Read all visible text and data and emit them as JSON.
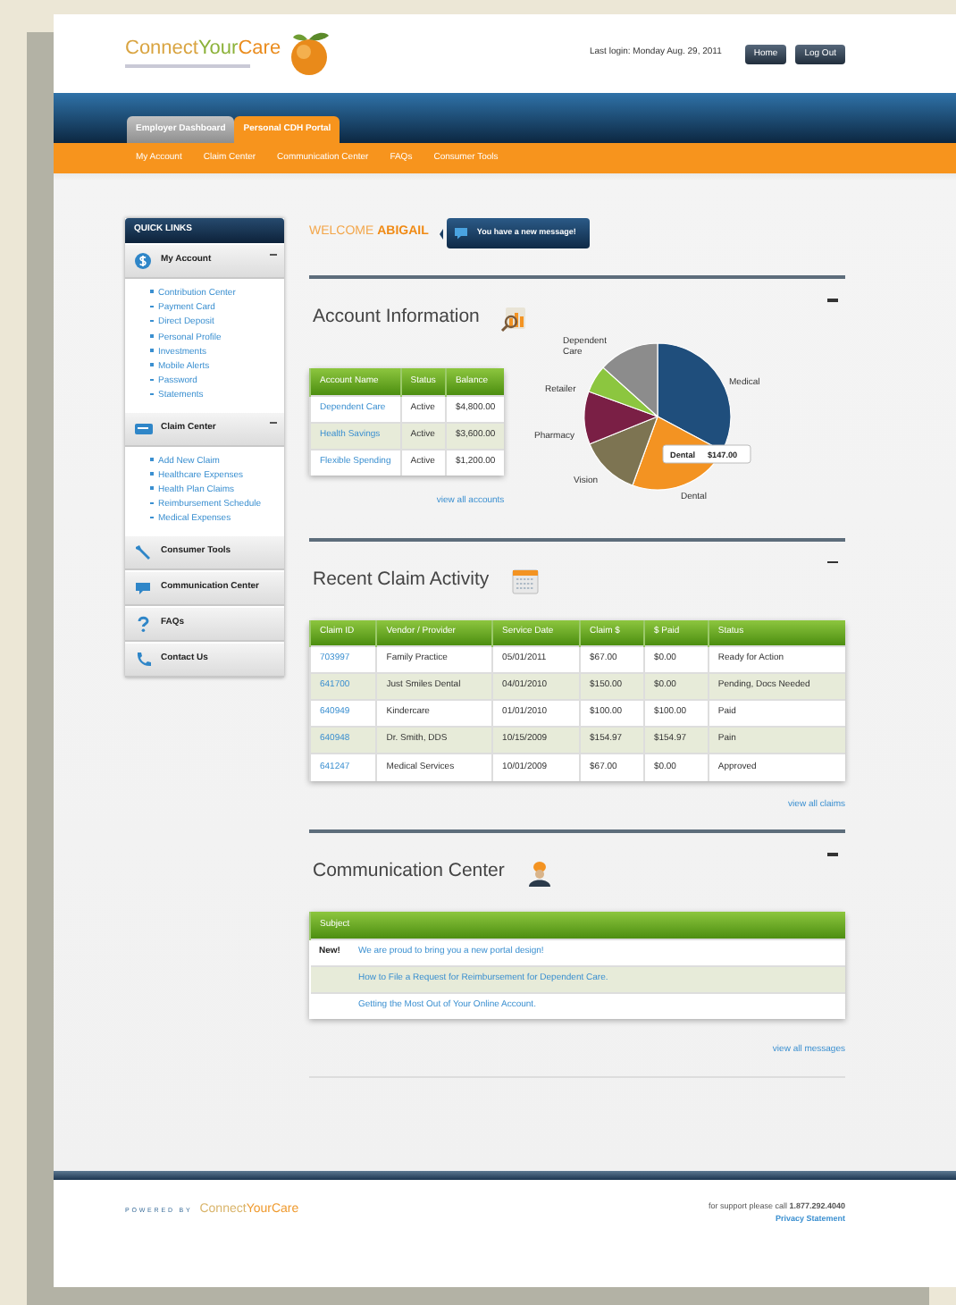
{
  "header": {
    "logo": [
      {
        "text": "Connect",
        "color": "#d9a441"
      },
      {
        "text": "Your",
        "color": "#8cb23a"
      },
      {
        "text": "Care",
        "color": "#ea8c1e"
      }
    ],
    "last_login": "Last login: Monday Aug. 29, 2011",
    "buttons": [
      "Home",
      "Log Out"
    ]
  },
  "portal_tabs": [
    {
      "label": "Employer Dashboard",
      "selected": false
    },
    {
      "label": "Personal CDH Portal",
      "selected": true
    }
  ],
  "nav": [
    "My Account",
    "Claim Center",
    "Communication Center",
    "FAQs",
    "Consumer Tools"
  ],
  "sidebar": {
    "title": "QUICK LINKS",
    "sections": [
      {
        "label": "My Account",
        "expanded": true,
        "links": [
          "Contribution Center",
          "Payment Card",
          "Direct Deposit",
          "Personal Profile",
          "Investments",
          "Mobile Alerts",
          "Password",
          "Statements"
        ]
      },
      {
        "label": "Claim Center",
        "expanded": true,
        "links": [
          "Add New Claim",
          "Healthcare Expenses",
          "Health Plan Claims",
          "Reimbursement Schedule",
          "Medical Expenses"
        ]
      },
      {
        "label": "Consumer Tools",
        "expanded": false
      },
      {
        "label": "Communication Center",
        "expanded": false
      },
      {
        "label": "FAQs",
        "expanded": false
      },
      {
        "label": "Contact Us",
        "expanded": false
      }
    ]
  },
  "welcome": "WELCOME **ABIGAIL**",
  "message_alert": "You have a new message!",
  "account_information": {
    "title": "Account Information",
    "columns": [
      "Account Name",
      "Status",
      "Balance"
    ],
    "rows": [
      [
        "Dependent Care",
        "Active",
        "$4,800.00"
      ],
      [
        "Health Savings",
        "Active",
        "$3,600.00"
      ],
      [
        "Flexible Spending",
        "Active",
        "$1,200.00"
      ]
    ],
    "link": "view all accounts",
    "pie": {
      "slices": [
        {
          "label": "Medical",
          "color": "#1f4e7c"
        },
        {
          "label": "Dental",
          "color": "#f39322"
        },
        {
          "label": "Vision",
          "color": "#7d7452"
        },
        {
          "label": "Pharmacy",
          "color": "#7a1f45"
        },
        {
          "label": "Retailer",
          "color": "#8cc63f"
        },
        {
          "label": "Dependent Care",
          "color": "#8c8c8c"
        }
      ],
      "tooltip": {
        "label": "Dental",
        "value": "$147.00"
      }
    }
  },
  "recent_claim_activity": {
    "title": "Recent Claim Activity",
    "columns": [
      "Claim ID",
      "Vendor / Provider",
      "Service Date",
      "Claim $",
      "$ Paid",
      "Status"
    ],
    "rows": [
      [
        "703997",
        "Family Practice",
        "05/01/2011",
        "$67.00",
        "$0.00",
        "Ready for Action"
      ],
      [
        "641700",
        "Just Smiles Dental",
        "04/01/2010",
        "$150.00",
        "$0.00",
        "Pending, Docs Needed"
      ],
      [
        "640949",
        "Kindercare",
        "01/01/2010",
        "$100.00",
        "$100.00",
        "Paid"
      ],
      [
        "640948",
        "Dr. Smith, DDS",
        "10/15/2009",
        "$154.97",
        "$154.97",
        "Pain"
      ],
      [
        "641247",
        "Medical Services",
        "10/01/2009",
        "$67.00",
        "$0.00",
        "Approved"
      ]
    ],
    "link": "view all claims"
  },
  "communication_center": {
    "title": "Communication Center",
    "columns": [
      "Subject"
    ],
    "rows": [
      {
        "badge": "New!",
        "subject": "We are proud to bring you a new portal design!"
      },
      {
        "subject": "How to File a Request for Reimbursement for Dependent Care."
      },
      {
        "subject": "Getting the Most Out of Your Online Account."
      }
    ],
    "link": "view all messages"
  },
  "footer": {
    "powered_by": "POWERED BY",
    "logo": [
      {
        "text": "Connect",
        "color": "#d9b46a"
      },
      {
        "text": "YourCare",
        "color": "#ef9a2e"
      }
    ],
    "support": "for support please call **1.877.292.4040**",
    "privacy_link": "Privacy Statement"
  }
}
